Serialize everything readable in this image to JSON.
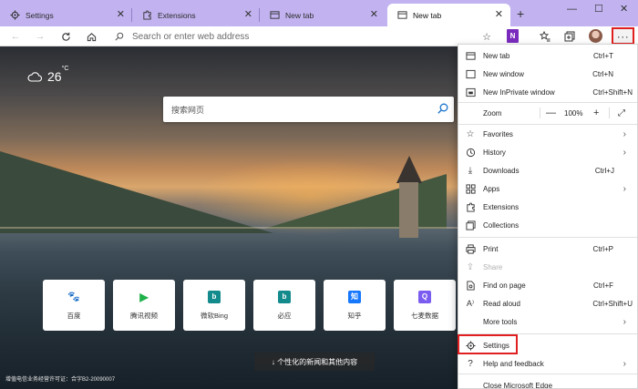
{
  "tabs": [
    {
      "label": "Settings",
      "icon": "gear-icon"
    },
    {
      "label": "Extensions",
      "icon": "puzzle-icon"
    },
    {
      "label": "New tab",
      "icon": "page-icon"
    },
    {
      "label": "New tab",
      "icon": "page-icon",
      "active": true
    }
  ],
  "toolbar": {
    "address_placeholder": "Search or enter web address",
    "onenote_label": "N"
  },
  "weather": {
    "temp": "26",
    "unit": "°C",
    "icon": "cloud-icon"
  },
  "search": {
    "placeholder": "搜索网页",
    "icon": "search-icon"
  },
  "tiles": [
    {
      "label": "百度",
      "icon": "baidu-icon",
      "color": "#2f68e6",
      "glyph": "🐾"
    },
    {
      "label": "腾讯视频",
      "icon": "tencent-video-icon",
      "color": "#20b14a",
      "glyph": "▶"
    },
    {
      "label": "微软Bing",
      "icon": "bing-icon",
      "color": "#138a8c",
      "glyph": "b"
    },
    {
      "label": "必应",
      "icon": "bing-icon",
      "color": "#138a8c",
      "glyph": "b"
    },
    {
      "label": "知乎",
      "icon": "zhihu-icon",
      "color": "#1677ff",
      "glyph": "知"
    },
    {
      "label": "七麦数据",
      "icon": "qimai-icon",
      "color": "#7b5cf0",
      "glyph": "Q"
    }
  ],
  "personalize_label": "↓ 个性化的新闻和其他内容",
  "license_text": "增值电信业务经营许可证：合字B2-20090007",
  "menu": {
    "new_tab": {
      "label": "New tab",
      "key": "Ctrl+T"
    },
    "new_window": {
      "label": "New window",
      "key": "Ctrl+N"
    },
    "new_inprivate": {
      "label": "New InPrivate window",
      "key": "Ctrl+Shift+N"
    },
    "zoom": {
      "label": "Zoom",
      "value": "100%",
      "minus": "—",
      "plus": "+"
    },
    "favorites": {
      "label": "Favorites"
    },
    "history": {
      "label": "History"
    },
    "downloads": {
      "label": "Downloads",
      "key": "Ctrl+J"
    },
    "apps": {
      "label": "Apps"
    },
    "extensions": {
      "label": "Extensions"
    },
    "collections": {
      "label": "Collections"
    },
    "print": {
      "label": "Print",
      "key": "Ctrl+P"
    },
    "share": {
      "label": "Share"
    },
    "find": {
      "label": "Find on page",
      "key": "Ctrl+F"
    },
    "read_aloud": {
      "label": "Read aloud",
      "key": "Ctrl+Shift+U"
    },
    "more_tools": {
      "label": "More tools"
    },
    "settings": {
      "label": "Settings"
    },
    "help": {
      "label": "Help and feedback"
    },
    "close": {
      "label": "Close Microsoft Edge"
    }
  },
  "colors": {
    "tabstrip": "#c2b3f0",
    "highlight": "#e02020"
  }
}
